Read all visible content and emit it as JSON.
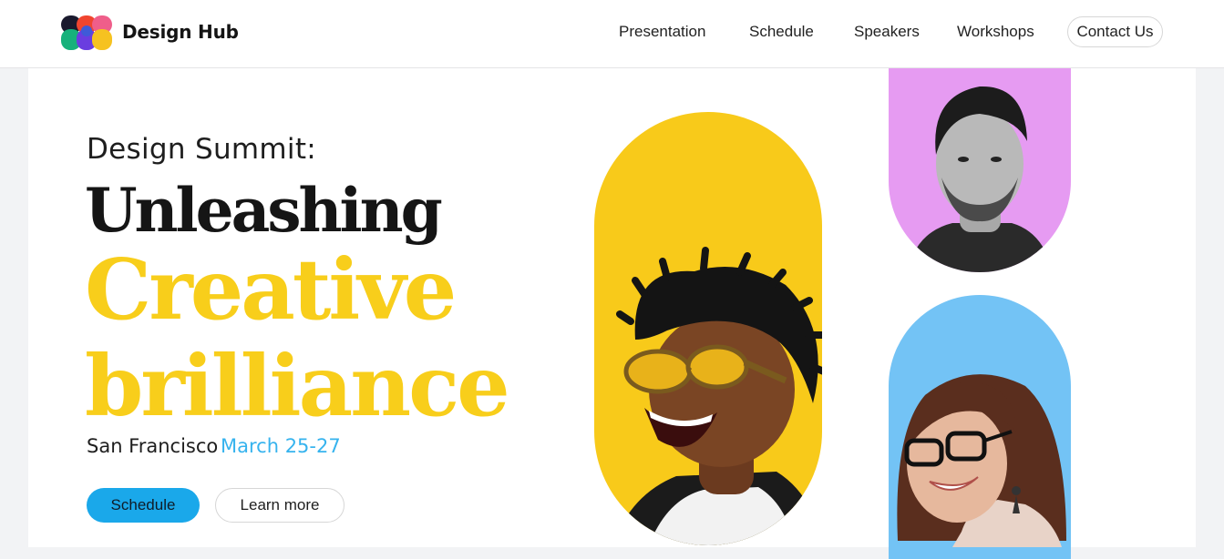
{
  "header": {
    "brand": "Design Hub",
    "nav": [
      "Presentation",
      "Schedule",
      "Speakers",
      "Workshops"
    ],
    "contact_label": "Contact Us"
  },
  "hero": {
    "subtitle": "Design Summit:",
    "headline_1": "Unleashing",
    "headline_2": "Creative",
    "headline_3": "brilliance",
    "location": "San Francisco",
    "dates": "March 25-27",
    "primary_button": "Schedule",
    "secondary_button": "Learn more"
  },
  "colors": {
    "accent_yellow": "#f8ce1b",
    "accent_blue": "#36b3ee",
    "button_blue": "#1aa8ea",
    "pink": "#e69bf2",
    "light_blue": "#73c3f5"
  },
  "icons": [
    "design-hub-logo-icon"
  ]
}
